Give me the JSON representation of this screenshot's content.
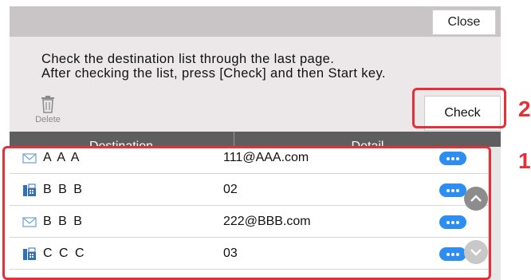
{
  "topbar": {
    "close_label": "Close"
  },
  "message": {
    "line1": "Check the destination list through the last page.",
    "line2": "After checking the list, press [Check] and then Start key."
  },
  "toolbar": {
    "delete_label": "Delete",
    "check_label": "Check"
  },
  "table": {
    "columns": {
      "destination": "Destination",
      "detail": "Detail"
    },
    "rows": [
      {
        "type": "email-icon",
        "name": "A A A",
        "detail": "111@AAA.com"
      },
      {
        "type": "fax-icon",
        "name": "B B B",
        "detail": "02"
      },
      {
        "type": "email-icon",
        "name": "B B B",
        "detail": "222@BBB.com"
      },
      {
        "type": "fax-icon",
        "name": "C C C",
        "detail": "03"
      }
    ]
  },
  "callouts": {
    "check": "2",
    "list": "1"
  },
  "colors": {
    "accent_blue": "#2b8ef0",
    "callout_red": "#e5303a",
    "header_gray": "#5e5e5e"
  }
}
